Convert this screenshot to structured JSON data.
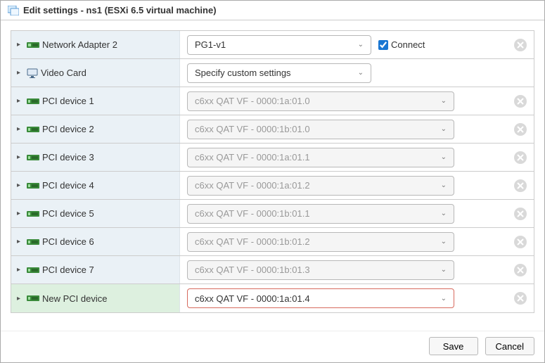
{
  "dialog": {
    "title": "Edit settings - ns1 (ESXi 6.5 virtual machine)"
  },
  "rows": {
    "network_adapter": {
      "label": "Network Adapter 2",
      "value": "PG1-v1",
      "connect_label": "Connect",
      "connected": true
    },
    "video_card": {
      "label": "Video Card",
      "value": "Specify custom settings"
    }
  },
  "pci_devices": [
    {
      "label": "PCI device 1",
      "value": "c6xx QAT VF - 0000:1a:01.0"
    },
    {
      "label": "PCI device 2",
      "value": "c6xx QAT VF - 0000:1b:01.0"
    },
    {
      "label": "PCI device 3",
      "value": "c6xx QAT VF - 0000:1a:01.1"
    },
    {
      "label": "PCI device 4",
      "value": "c6xx QAT VF - 0000:1a:01.2"
    },
    {
      "label": "PCI device 5",
      "value": "c6xx QAT VF - 0000:1b:01.1"
    },
    {
      "label": "PCI device 6",
      "value": "c6xx QAT VF - 0000:1b:01.2"
    },
    {
      "label": "PCI device 7",
      "value": "c6xx QAT VF - 0000:1b:01.3"
    }
  ],
  "new_pci_device": {
    "label": "New PCI device",
    "value": "c6xx QAT VF - 0000:1a:01.4"
  },
  "footer": {
    "save": "Save",
    "cancel": "Cancel"
  }
}
